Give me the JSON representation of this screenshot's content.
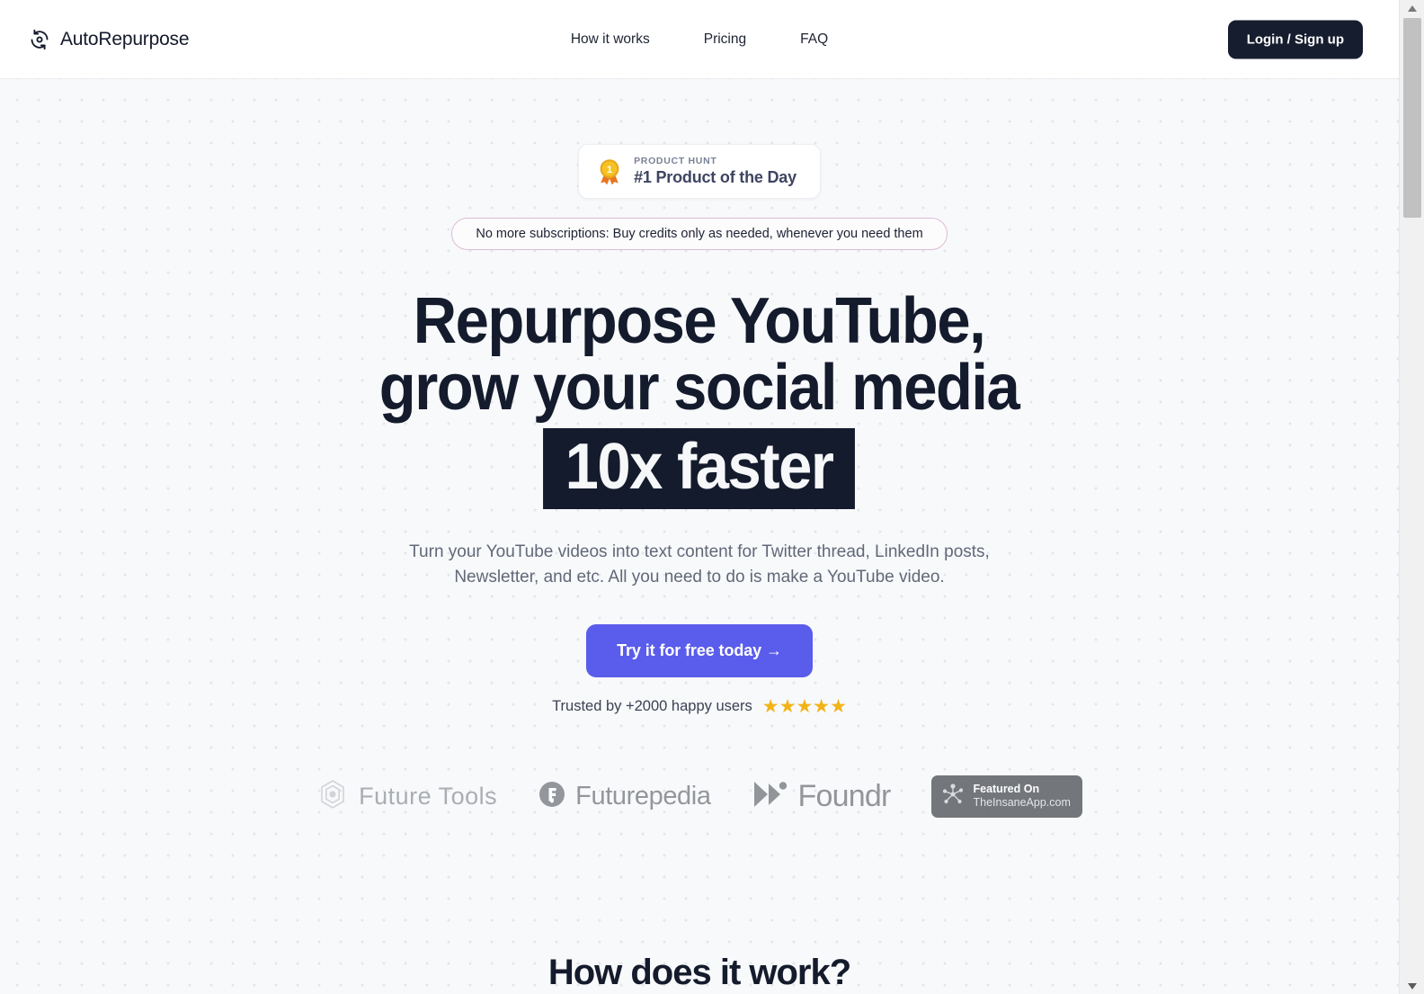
{
  "header": {
    "brand_name": "AutoRepurpose",
    "brand_icon": "refresh-cycle-icon",
    "nav": [
      {
        "label": "How it works"
      },
      {
        "label": "Pricing"
      },
      {
        "label": "FAQ"
      }
    ],
    "login_label": "Login / Sign up",
    "login_bg": "#161d2f"
  },
  "hero": {
    "product_hunt": {
      "icon": "gold-medal-icon",
      "kicker": "PRODUCT HUNT",
      "title": "#1 Product of the Day"
    },
    "credits_pill": "No more subscriptions: Buy credits only as needed, whenever you need them",
    "pill_border_color": "#dcbcd4",
    "headline": {
      "line1": "Repurpose YouTube,",
      "line2": "grow your social media",
      "highlight": "10x faster",
      "highlight_bg": "#141b2c"
    },
    "subtitle": {
      "line1": "Turn your YouTube videos into text content for Twitter thread, LinkedIn posts,",
      "line2": "Newsletter, and etc. All you need to do is make a YouTube video."
    },
    "cta": {
      "label": "Try it for free today  →",
      "bg": "#5a5ceb"
    },
    "trust": {
      "text": "Trusted by +2000 happy users",
      "stars": "★★★★★",
      "star_color": "#f2b318"
    },
    "logos": [
      {
        "name": "Future Tools",
        "icon": "hexagon-logo-icon"
      },
      {
        "name": "Futurepedia",
        "icon": "circle-f-logo-icon"
      },
      {
        "name": "Foundr",
        "icon": "double-chevron-logo-icon"
      }
    ],
    "insane_badge": {
      "icon": "molecule-network-icon",
      "line1": "Featured On",
      "line2": "TheInsaneApp.com",
      "bg": "#6c6f74"
    }
  },
  "how_section": {
    "heading": "How does it work?"
  },
  "scrollbar": {
    "up_icon": "scroll-up-arrow-icon",
    "down_icon": "scroll-down-arrow-icon"
  }
}
